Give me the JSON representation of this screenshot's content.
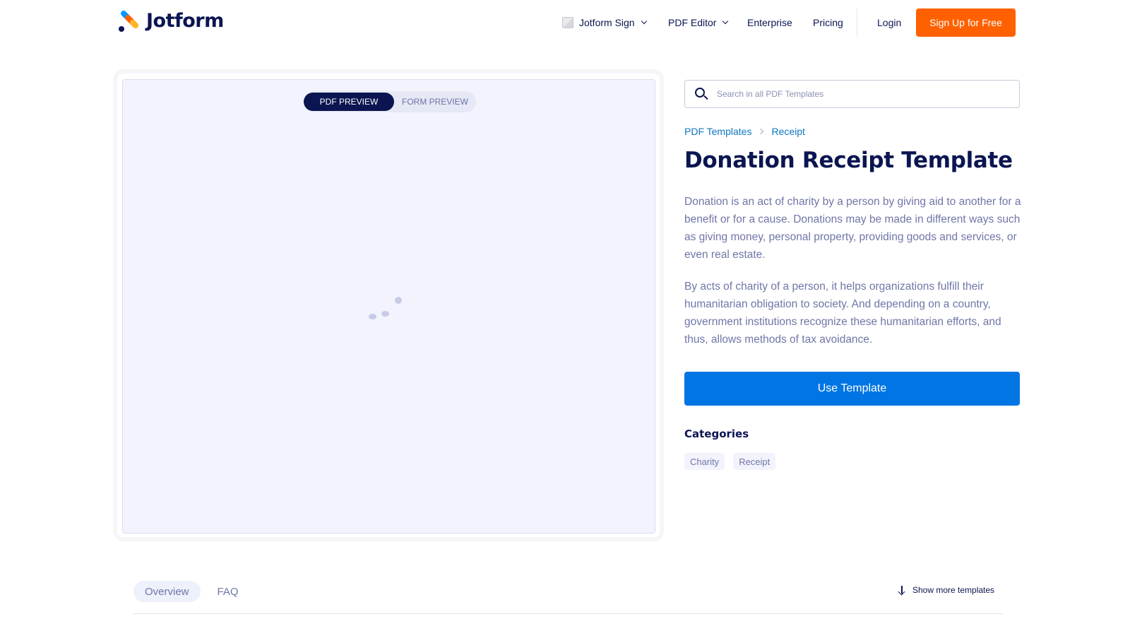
{
  "header": {
    "logo_text": "Jotform",
    "nav": {
      "sign_label": "Jotform Sign",
      "pdf_editor_label": "PDF Editor",
      "enterprise_label": "Enterprise",
      "pricing_label": "Pricing",
      "login_label": "Login",
      "signup_label": "Sign Up for Free"
    }
  },
  "preview": {
    "toggle": {
      "active_label": "PDF PREVIEW",
      "inactive_label": "FORM PREVIEW"
    }
  },
  "search": {
    "placeholder": "Search in all PDF Templates",
    "value": ""
  },
  "breadcrumb": {
    "items": [
      "PDF Templates",
      "Receipt"
    ]
  },
  "main": {
    "title": "Donation Receipt Template",
    "description": [
      "Donation is an act of charity by a person by giving aid to another for a benefit or for a cause. Donations may be made in different ways such as giving money, personal property, providing goods and services, or even real estate.",
      "By acts of charity of a person, it helps organizations fulfill their humanitarian obligation to society. And depending on a country, government institutions recognize these humanitarian efforts, and thus, allows methods of tax avoidance."
    ],
    "use_template_label": "Use Template",
    "categories_title": "Categories",
    "categories": [
      "Charity",
      "Receipt"
    ]
  },
  "bottom": {
    "tabs": [
      "Overview",
      "FAQ"
    ],
    "show_more_label": "Show more templates"
  },
  "colors": {
    "brand_navy": "#0a1551",
    "signup_orange": "#ff6100",
    "primary_blue": "#0075e3",
    "link_blue": "#0e77c2"
  }
}
